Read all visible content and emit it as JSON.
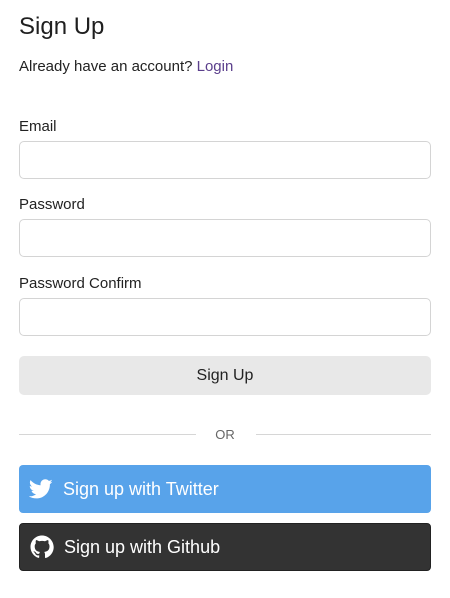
{
  "header": {
    "title": "Sign Up",
    "account_prompt": "Already have an account?",
    "login_link": "Login"
  },
  "form": {
    "email_label": "Email",
    "email_value": "",
    "password_label": "Password",
    "password_value": "",
    "password_confirm_label": "Password Confirm",
    "password_confirm_value": "",
    "submit_label": "Sign Up"
  },
  "divider": {
    "label": "OR"
  },
  "social": {
    "twitter": {
      "label": "Sign up with Twitter",
      "icon": "twitter-bird-icon",
      "color": "#58a3ea"
    },
    "github": {
      "label": "Sign up with Github",
      "icon": "github-octocat-icon",
      "color": "#333333"
    }
  },
  "colors": {
    "link": "#5b3f8c",
    "submit_bg": "#e8e8e8",
    "input_border": "#d4d4d4"
  }
}
